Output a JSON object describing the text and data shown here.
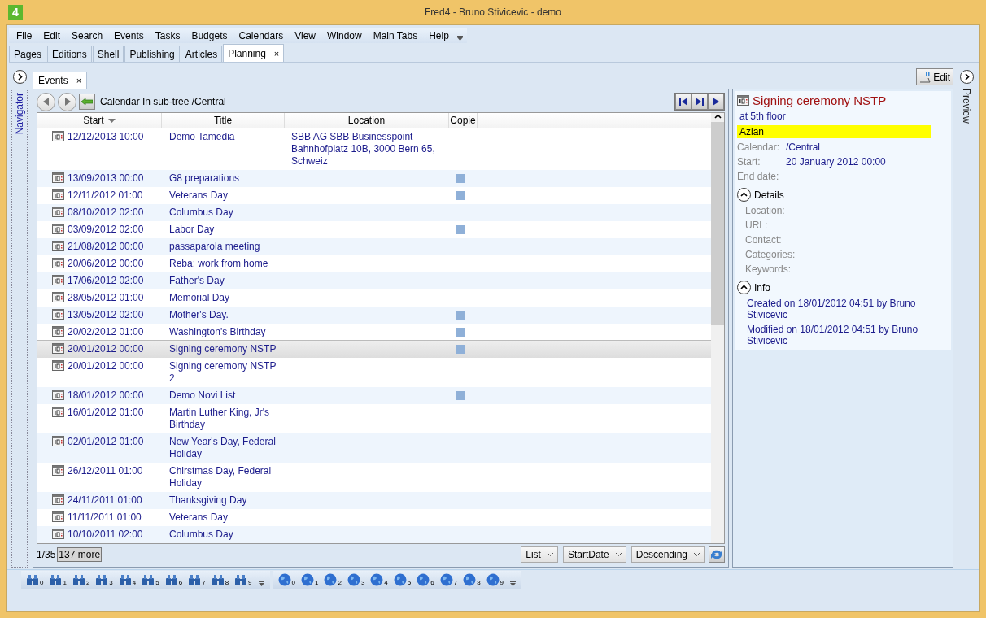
{
  "window": {
    "title": "Fred4 - Bruno Stivicevic - demo",
    "logo": "4"
  },
  "menu": [
    "File",
    "Edit",
    "Search",
    "Events",
    "Tasks",
    "Budgets",
    "Calendars",
    "View",
    "Window",
    "Main Tabs",
    "Help"
  ],
  "main_tabs": [
    {
      "label": "Pages",
      "selected": false
    },
    {
      "label": "Editions",
      "selected": false
    },
    {
      "label": "Shell",
      "selected": false
    },
    {
      "label": "Publishing",
      "selected": false
    },
    {
      "label": "Articles",
      "selected": false
    },
    {
      "label": "Planning",
      "selected": true,
      "close": "×"
    }
  ],
  "navigator": {
    "label": "Navigator"
  },
  "events_tab": {
    "label": "Events",
    "close": "×",
    "selected": true
  },
  "toolbar": {
    "filter": "Calendar In sub-tree /Central"
  },
  "table": {
    "columns": [
      {
        "label": "Start",
        "sorted": true
      },
      {
        "label": "Title",
        "sorted": false
      },
      {
        "label": "Location",
        "sorted": false
      },
      {
        "label": "Copie",
        "sorted": false
      }
    ],
    "rows": [
      {
        "start": "12/12/2013 10:00",
        "title": "Demo Tamedia",
        "location": "SBB AG SBB Businesspoint Bahnhofplatz 10B, 3000 Bern 65, Schweiz",
        "copies": false,
        "selected": false
      },
      {
        "start": "13/09/2013 00:00",
        "title": "G8 preparations",
        "copies": true,
        "selected": false
      },
      {
        "start": "12/11/2012 01:00",
        "title": "Veterans Day",
        "copies": true,
        "selected": false
      },
      {
        "start": "08/10/2012 02:00",
        "title": "Columbus Day",
        "copies": false,
        "selected": false
      },
      {
        "start": "03/09/2012 02:00",
        "title": "Labor Day",
        "copies": true,
        "selected": false
      },
      {
        "start": "21/08/2012 00:00",
        "title": "passaparola meeting",
        "copies": false,
        "selected": false
      },
      {
        "start": "20/06/2012 00:00",
        "title": "Reba: work from home",
        "copies": false,
        "selected": false
      },
      {
        "start": "17/06/2012 02:00",
        "title": "Father's Day",
        "copies": false,
        "selected": false
      },
      {
        "start": "28/05/2012 01:00",
        "title": "Memorial Day",
        "copies": false,
        "selected": false
      },
      {
        "start": "13/05/2012 02:00",
        "title": "Mother's Day.",
        "copies": true,
        "selected": false
      },
      {
        "start": "20/02/2012 01:00",
        "title": "Washington's Birthday",
        "copies": true,
        "selected": false
      },
      {
        "start": "20/01/2012 00:00",
        "title": "Signing ceremony NSTP",
        "copies": true,
        "selected": true
      },
      {
        "start": "20/01/2012 00:00",
        "title": "Signing ceremony NSTP 2",
        "copies": false,
        "selected": false
      },
      {
        "start": "18/01/2012 00:00",
        "title": "Demo Novi List",
        "copies": true,
        "selected": false
      },
      {
        "start": "16/01/2012 01:00",
        "title": "Martin Luther King, Jr's Birthday",
        "copies": false,
        "selected": false
      },
      {
        "start": "02/01/2012 01:00",
        "title": "New Year's Day, Federal Holiday",
        "copies": false,
        "selected": false
      },
      {
        "start": "26/12/2011 01:00",
        "title": "Chirstmas Day, Federal Holiday",
        "copies": false,
        "selected": false
      },
      {
        "start": "24/11/2011 01:00",
        "title": "Thanksgiving Day",
        "copies": false,
        "selected": false
      },
      {
        "start": "11/11/2011 01:00",
        "title": "Veterans Day",
        "copies": false,
        "selected": false
      },
      {
        "start": "10/10/2011 02:00",
        "title": "Columbus Day",
        "copies": false,
        "selected": false
      }
    ]
  },
  "footer": {
    "count": "1/35",
    "more": "137 more",
    "view": "List",
    "sort_field": "StartDate",
    "order": "Descending"
  },
  "edit_button": "Edit",
  "preview": {
    "title": "Signing ceremony NSTP",
    "subtitle": "at 5th floor",
    "highlight": "Azlan",
    "fields": [
      {
        "label": "Calendar:",
        "value": "/Central"
      },
      {
        "label": "Start:",
        "value": "20 January 2012 00:00"
      },
      {
        "label": "End date:"
      }
    ],
    "sections": [
      {
        "title": "Details",
        "expanded": true,
        "labels": [
          "Location:",
          "URL:",
          "Contact:",
          "Categories:",
          "Keywords:"
        ]
      },
      {
        "title": "Info",
        "expanded": true,
        "lines": [
          "Created on 18/01/2012 04:51 by Bruno Stivicevic",
          "Modified on 18/01/2012 04:51 by Bruno Stivicevic"
        ]
      }
    ]
  },
  "preview_strip": {
    "label": "Preview"
  },
  "quick_bars": {
    "binoculars": [
      "0",
      "1",
      "2",
      "3",
      "4",
      "5",
      "6",
      "7",
      "8",
      "9"
    ],
    "globes": [
      "0",
      "1",
      "2",
      "3",
      "4",
      "5",
      "6",
      "7",
      "8",
      "9"
    ]
  }
}
